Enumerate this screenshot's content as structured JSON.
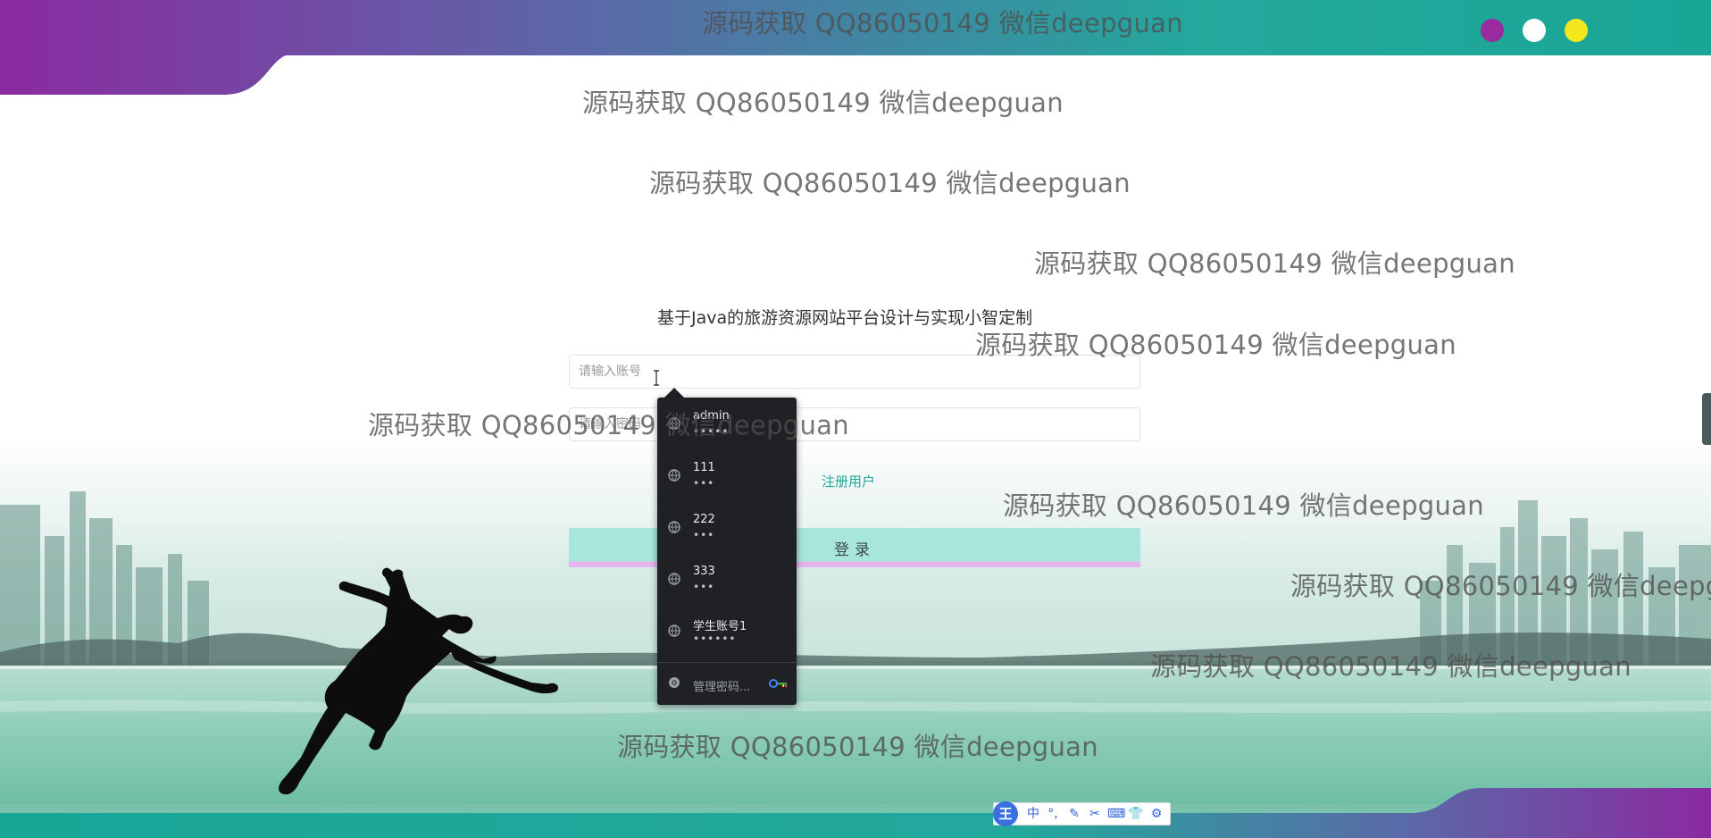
{
  "window": {
    "dot_colors": [
      "#9b2a9e",
      "#ffffff",
      "#f2e81d"
    ]
  },
  "watermark": {
    "text": "源码获取 QQ86050149 微信deepguan",
    "text_cut": "源码获取 QQ86050149 微信deepg"
  },
  "login": {
    "title": "基于Java的旅游资源网站平台设计与实现小智定制",
    "account_placeholder": "请输入账号",
    "password_placeholder": "请输入密码",
    "register_label": "注册用户",
    "login_label": "登录"
  },
  "autofill": {
    "items": [
      {
        "username": "admin",
        "password_mask": "•••••"
      },
      {
        "username": "111",
        "password_mask": "•••"
      },
      {
        "username": "222",
        "password_mask": "•••"
      },
      {
        "username": "333",
        "password_mask": "•••"
      },
      {
        "username": "学生账号1",
        "password_mask": "••••••"
      }
    ],
    "manage_label": "管理密码..."
  },
  "ime": {
    "logo": "王",
    "items": [
      "中",
      "°,",
      "✎",
      "✂",
      "⌨",
      "👕",
      "⚙"
    ]
  },
  "colors": {
    "accent": "#22a597",
    "brand_purple": "#8a2aa0",
    "login_button": "#a8e6dc",
    "dropdown_bg": "#202124"
  }
}
